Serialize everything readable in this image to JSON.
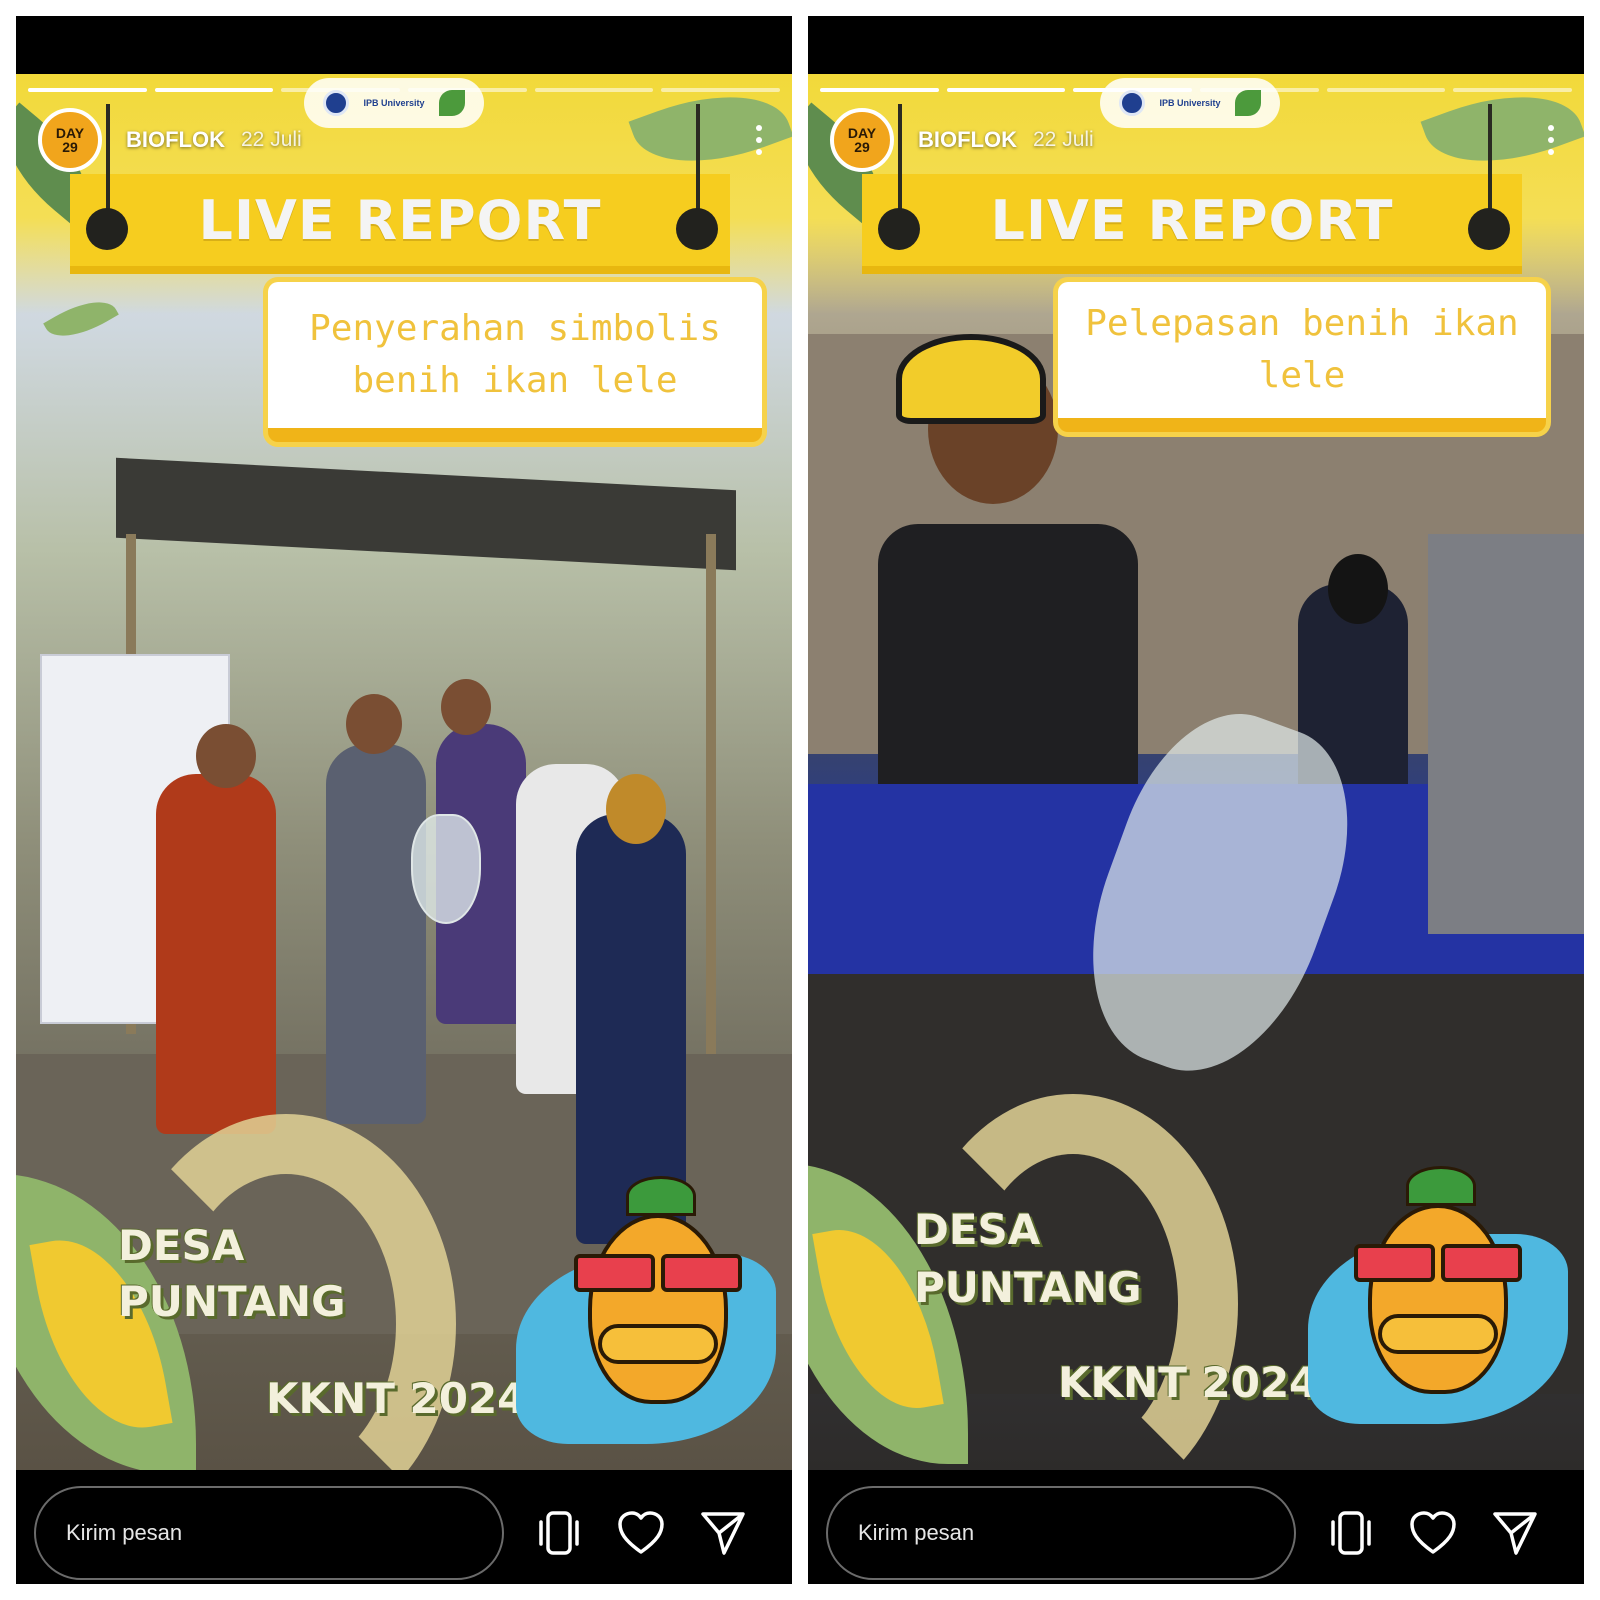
{
  "stories": [
    {
      "user": {
        "avatar_top": "DAY",
        "avatar_bottom": "29",
        "name": "BIOFLOK",
        "date": "22 Juli"
      },
      "banner": "LIVE REPORT",
      "caption": "Penyerahan simbolis\nbenih ikan lele",
      "location_line1": "DESA",
      "location_line2": "PUNTANG",
      "program": "KKNT 2024",
      "message_placeholder": "Kirim pesan",
      "progress_segments": 6,
      "progress_done": 2
    },
    {
      "user": {
        "avatar_top": "DAY",
        "avatar_bottom": "29",
        "name": "BIOFLOK",
        "date": "22 Juli"
      },
      "banner": "LIVE REPORT",
      "caption": "Pelepasan benih ikan lele",
      "location_line1": "DESA",
      "location_line2": "PUNTANG",
      "program": "KKNT 2024",
      "message_placeholder": "Kirim pesan",
      "progress_segments": 6,
      "progress_done": 3
    }
  ],
  "icons": [
    "more-options-icon",
    "boomerang-icon",
    "heart-icon",
    "send-icon"
  ],
  "colors": {
    "banner_yellow": "#f6cd1f",
    "caption_text": "#f0c23c",
    "avatar_orange": "#f1a51c"
  }
}
